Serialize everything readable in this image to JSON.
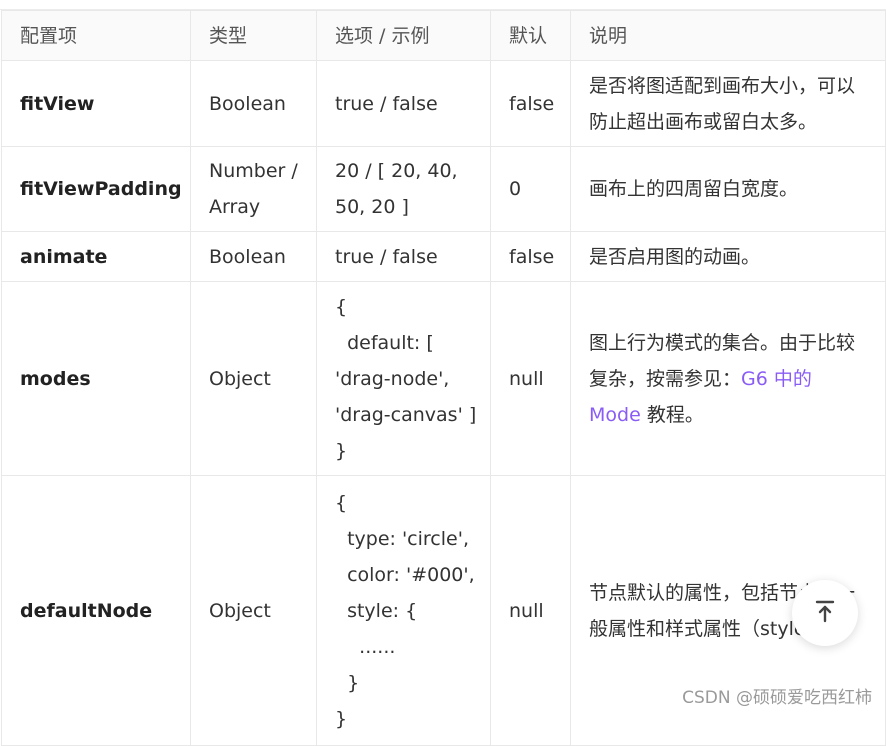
{
  "headers": [
    "配置项",
    "类型",
    "选项 / 示例",
    "默认",
    "说明"
  ],
  "rows": [
    {
      "key": "fitView",
      "type": "Boolean",
      "option": "true / false",
      "default": "false",
      "desc": "是否将图适配到画布大小，可以防止超出画布或留白太多。"
    },
    {
      "key": "fitViewPadding",
      "type": "Number / Array",
      "option": "20 / [ 20, 40, 50, 20 ]",
      "default": "0",
      "desc": "画布上的四周留白宽度。"
    },
    {
      "key": "animate",
      "type": "Boolean",
      "option": "true / false",
      "default": "false",
      "desc": "是否启用图的动画。"
    },
    {
      "key": "modes",
      "type": "Object",
      "option": "{\n  default: [\n'drag-node',\n'drag-canvas' ]\n}",
      "default": "null",
      "desc_pre": "图上行为模式的集合。由于比较复杂，按需参见：",
      "desc_link": "G6 中的 Mode",
      "desc_post": " 教程。"
    },
    {
      "key": "defaultNode",
      "type": "Object",
      "option": "{\n  type: 'circle',\n  color: '#000',\n  style: {\n    ......\n  }\n}",
      "default": "null",
      "desc": "节点默认的属性，包括节点的一般属性和样式属性（style）。"
    }
  ],
  "watermark": "CSDN @硕硕爱吃西红柿",
  "colors": {
    "link": "#8a5cf6",
    "header_bg": "#fafafa",
    "border": "#e8e8e8"
  },
  "icons": {
    "back_to_top": "arrow-up-to-line-icon"
  }
}
